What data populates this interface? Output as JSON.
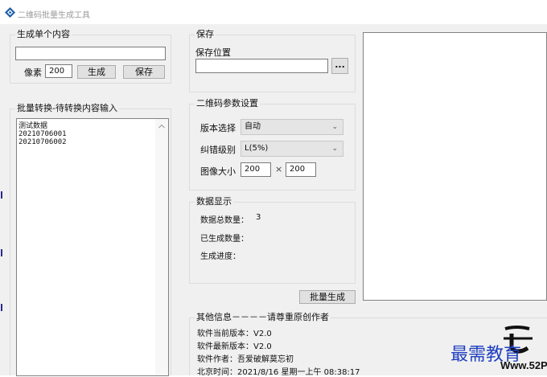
{
  "window": {
    "title": "二维码批量生成工具",
    "icon": "app-diamond-icon"
  },
  "single": {
    "legend": "生成单个内容",
    "content_value": "",
    "pixel_label": "像素",
    "pixel_value": "200",
    "generate_button": "生成",
    "save_button": "保存"
  },
  "batch": {
    "legend": "批量转换-待转换内容输入",
    "lines": [
      "测试数据",
      "20210706001",
      "20210706002"
    ]
  },
  "save": {
    "legend": "保存",
    "location_label": "保存位置",
    "path_value": "",
    "browse_button": "..."
  },
  "params": {
    "legend": "二维码参数设置",
    "version_label": "版本选择",
    "version_value": "自动",
    "ecc_label": "纠错级别",
    "ecc_value": "L(5%)",
    "size_label": "图像大小",
    "width_value": "200",
    "times": "×",
    "height_value": "200"
  },
  "data_display": {
    "legend": "数据显示",
    "total_label": "数据总数量：",
    "total_value": "3",
    "generated_label": "已生成数量：",
    "generated_value": "",
    "progress_label": "生成进度：",
    "progress_value": ""
  },
  "batch_generate_button": "批量生成",
  "other_info": {
    "legend": "其他信息－－－－请尊重原创作者",
    "current_version": "软件当前版本：V2.0",
    "latest_version": "软件最新版本：V2.0",
    "author": "软件作者：吾爱破解莫忘初",
    "time": "北京时间：2021/8/16 星期一上午 08:38:17"
  },
  "watermark": {
    "text": "最需教育",
    "url_text": "Www.52P"
  },
  "colors": {
    "window_bg": "#f0f0f0",
    "title_text": "#9a9a9a",
    "button_bg": "#e1e1e1",
    "watermark_blue": "#1f3fbf",
    "icon_blue": "#1e5fa8"
  }
}
